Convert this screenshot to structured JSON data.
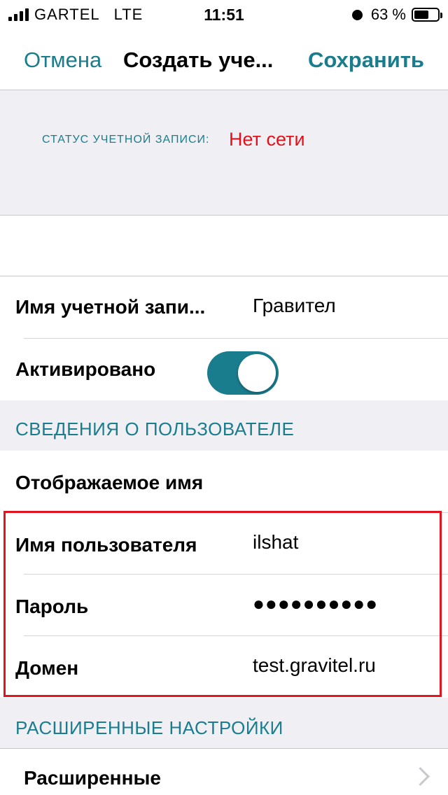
{
  "status_bar": {
    "carrier": "GARTEL",
    "network": "LTE",
    "time": "11:51",
    "battery": "63 %"
  },
  "nav": {
    "cancel": "Отмена",
    "title": "Создать уче...",
    "save": "Сохранить"
  },
  "account_status": {
    "label": "СТАТУС УЧЕТНОЙ ЗАПИСИ:",
    "value": "Нет сети"
  },
  "account": {
    "name_label": "Имя учетной запи...",
    "name_value": "Гравител",
    "activated_label": "Активировано",
    "activated": true
  },
  "user_section": {
    "header": "СВЕДЕНИЯ О ПОЛЬЗОВАТЕЛЕ",
    "display_name_label": "Отображаемое имя",
    "username_label": "Имя пользователя",
    "username_value": "ilshat",
    "password_label": "Пароль",
    "password_value": "●●●●●●●●●●",
    "domain_label": "Домен",
    "domain_value": "test.gravitel.ru"
  },
  "advanced_section": {
    "header": "РАСШИРЕННЫЕ НАСТРОЙКИ",
    "advanced_label": "Расширенные"
  },
  "colors": {
    "accent": "#1a7d8e",
    "error": "#e0121b",
    "highlight": "#e3141f"
  }
}
